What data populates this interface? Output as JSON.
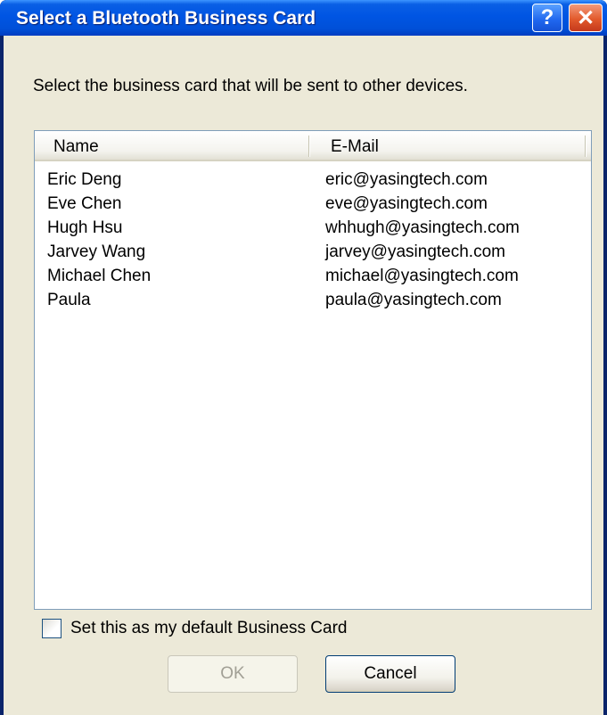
{
  "window": {
    "title": "Select a Bluetooth Business Card",
    "help_label": "?",
    "close_label": "✕"
  },
  "instruction": "Select the business card that will be sent to other devices.",
  "list": {
    "columns": [
      "Name",
      "E-Mail"
    ],
    "rows": [
      {
        "name": "Eric Deng",
        "email": "eric@yasingtech.com"
      },
      {
        "name": "Eve Chen",
        "email": "eve@yasingtech.com"
      },
      {
        "name": "Hugh Hsu",
        "email": "whhugh@yasingtech.com"
      },
      {
        "name": "Jarvey Wang",
        "email": "jarvey@yasingtech.com"
      },
      {
        "name": "Michael Chen",
        "email": "michael@yasingtech.com"
      },
      {
        "name": "Paula",
        "email": "paula@yasingtech.com"
      }
    ]
  },
  "default_checkbox": {
    "label": "Set this as my default Business Card",
    "checked": false
  },
  "buttons": {
    "ok": "OK",
    "cancel": "Cancel"
  },
  "colors": {
    "titlebar": "#0055e3",
    "dialog_bg": "#ece9d8",
    "close_button": "#e25a2c"
  }
}
